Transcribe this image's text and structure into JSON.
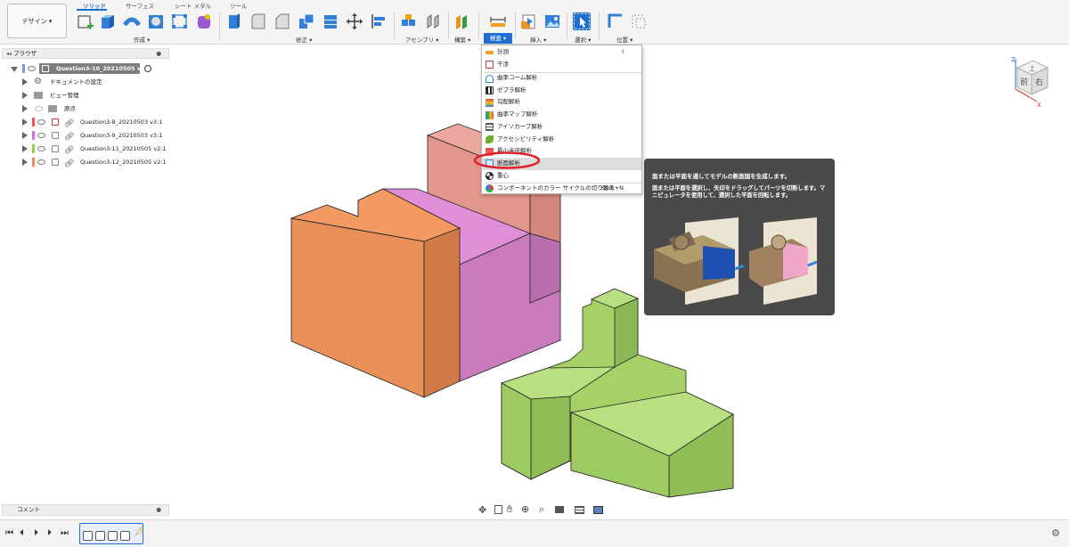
{
  "toolbar": {
    "workspace_label": "デザイン ▾",
    "tabs": [
      "ソリッド",
      "サーフェス",
      "シート メタル",
      "ツール"
    ],
    "groups": {
      "create": "作成 ▾",
      "modify": "修正 ▾",
      "assemble": "アセンブリ ▾",
      "construct": "構築 ▾",
      "inspect": "検査 ▾",
      "insert": "挿入 ▾",
      "select": "選択 ▾",
      "position": "位置 ▾"
    },
    "active_tab_color": "#1e6fd0"
  },
  "browser": {
    "title": "ブラウザ",
    "root": "Question3-10_20210505 v5",
    "items": [
      {
        "label": "ドキュメントの設定"
      },
      {
        "label": "ビュー管理"
      },
      {
        "label": "原点"
      },
      {
        "label": "Question3-8_20210503 v3:1",
        "color": "#f05050"
      },
      {
        "label": "Question3-9_20210503 v3:1",
        "color": "#d86fd8"
      },
      {
        "label": "Question3-11_20210505 v2:1",
        "color": "#8ed05a"
      },
      {
        "label": "Question3-12_20210505 v2:1",
        "color": "#f08a50"
      }
    ]
  },
  "comments_label": "コメント",
  "inspect_menu": {
    "items": [
      {
        "label": "計測",
        "shortcut": "I",
        "icon": "measure-icon"
      },
      {
        "label": "干渉",
        "icon": "interference-icon"
      },
      {
        "label": "曲率コーム解析",
        "icon": "curvature-comb-icon"
      },
      {
        "label": "ゼブラ解析",
        "icon": "zebra-icon"
      },
      {
        "label": "勾配解析",
        "icon": "draft-icon"
      },
      {
        "label": "曲率マップ解析",
        "icon": "curvature-map-icon"
      },
      {
        "label": "アイソカーブ解析",
        "icon": "isocurve-icon"
      },
      {
        "label": "アクセシビリティ解析",
        "icon": "accessibility-icon"
      },
      {
        "label": "最小半径解析",
        "icon": "min-radius-icon"
      },
      {
        "label": "断面解析",
        "icon": "section-analysis-icon",
        "highlighted": true
      },
      {
        "label": "重心",
        "icon": "center-of-mass-icon"
      },
      {
        "label": "コンポーネントのカラー サイクルの切り替え",
        "shortcut": "Shift+N",
        "icon": "color-cycle-icon"
      }
    ]
  },
  "tooltip": {
    "title": "面または平面を通してモデルの断面図を生成します。",
    "body": "面または平面を選択し、矢印をドラッグしてパーツを切断します。マニピュレータを使用して、選択した平面を回転します。"
  },
  "viewcube": {
    "front": "前",
    "right": "右",
    "top": "上",
    "x": "X",
    "z": "Z"
  },
  "model_colors": {
    "orange": "#e98f58",
    "pink": "#e7a096",
    "magenta": "#c77cc0",
    "green": "#9bcc5c"
  }
}
